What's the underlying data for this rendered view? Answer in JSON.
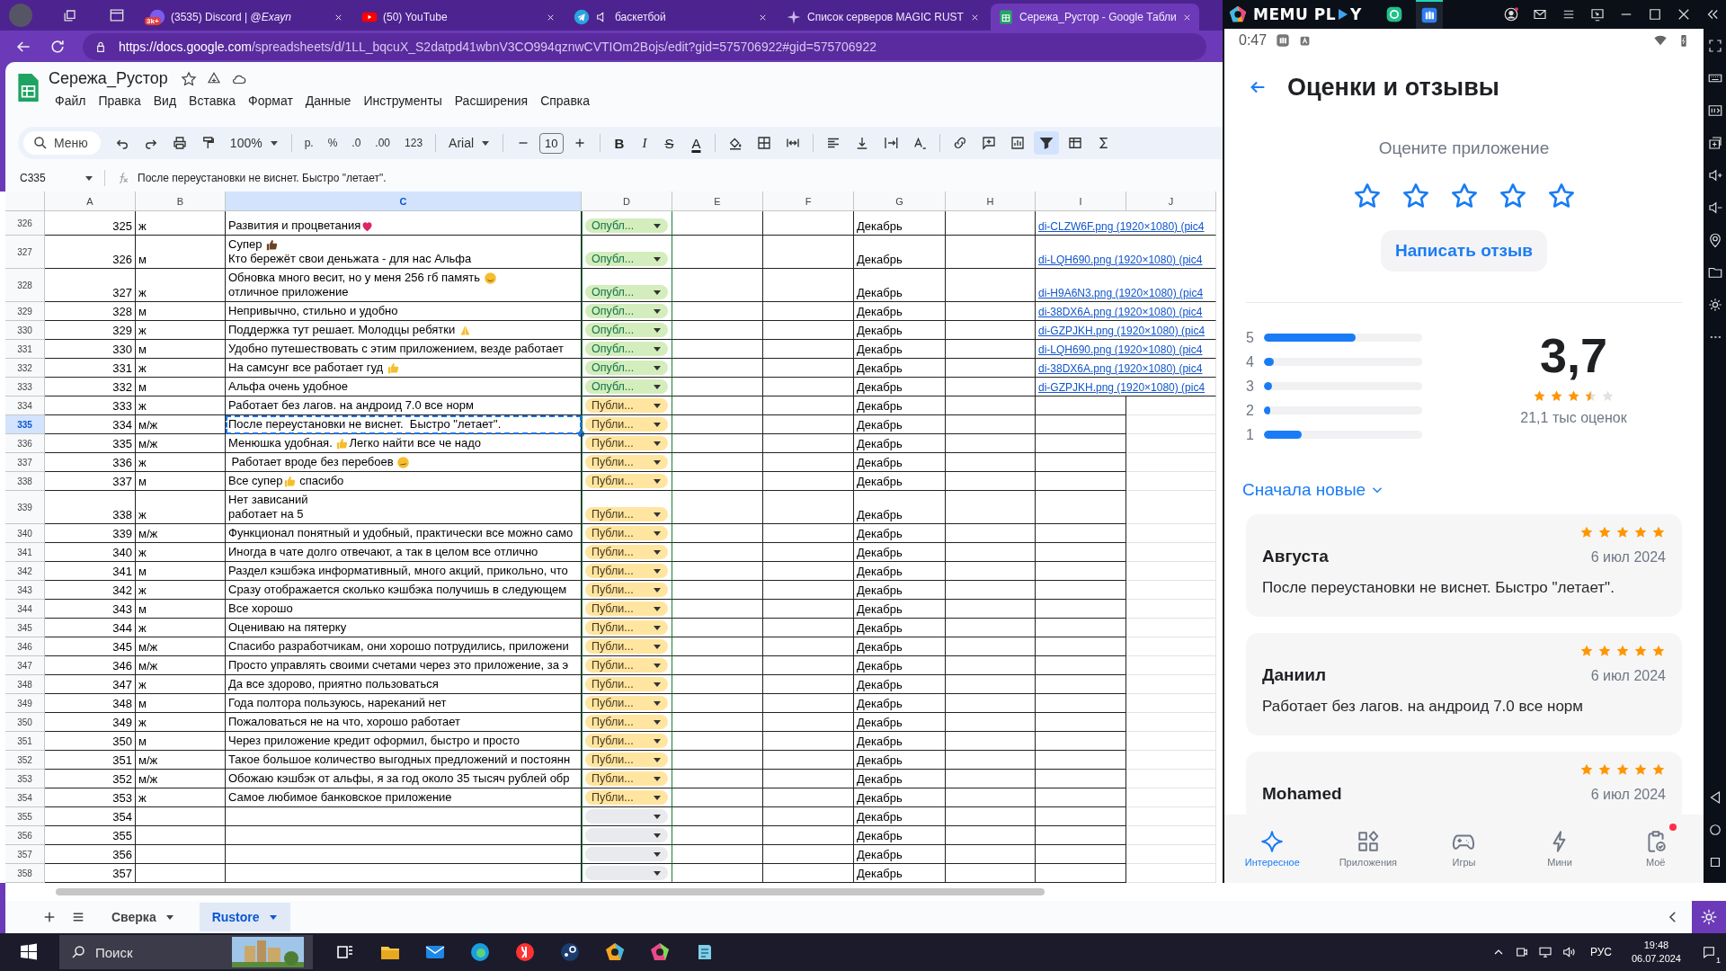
{
  "browser": {
    "tabs": [
      {
        "title": "(3535) Discord | @*Exayn*",
        "kind": "discord",
        "badge": "3k+",
        "audio": false,
        "selected": false
      },
      {
        "title": "(50) YouTube",
        "kind": "youtube",
        "audio": false,
        "selected": false
      },
      {
        "title": "баскетбой",
        "kind": "telegram",
        "audio": true,
        "selected": false
      },
      {
        "title": "Список серверов MAGIC RUST",
        "kind": "rust",
        "audio": false,
        "selected": false
      },
      {
        "title": "Сережа_Рустор - Google Табли",
        "kind": "sheets",
        "audio": false,
        "selected": true
      }
    ],
    "url_host": "https://docs.google.com",
    "url_path": "/spreadsheets/d/1LL_bqcuX_S2datpd41wbnV3CO994qznwCVTIOm2Bojs/edit?gid=575706922#gid=575706922"
  },
  "sheets": {
    "title": "Сережа_Рустор",
    "menu": [
      "Файл",
      "Правка",
      "Вид",
      "Вставка",
      "Формат",
      "Данные",
      "Инструменты",
      "Расширения",
      "Справка"
    ],
    "toolbar": [
      {
        "kind": "search",
        "label": "Меню"
      },
      {
        "kind": "undo",
        "active": false
      },
      {
        "kind": "redo",
        "active": false
      },
      {
        "kind": "print",
        "active": false
      },
      {
        "kind": "paint",
        "active": false
      },
      {
        "kind": "select",
        "label": "100%"
      },
      {
        "kind": "divider"
      },
      {
        "kind": "text",
        "label": "р."
      },
      {
        "kind": "text",
        "label": "%"
      },
      {
        "kind": "text",
        "label": ".0"
      },
      {
        "kind": "text",
        "label": ".00"
      },
      {
        "kind": "text",
        "label": "123"
      },
      {
        "kind": "divider"
      },
      {
        "kind": "select",
        "label": "Arial"
      },
      {
        "kind": "divider"
      },
      {
        "kind": "minus",
        "active": false
      },
      {
        "kind": "field",
        "label": "10"
      },
      {
        "kind": "plus",
        "active": false
      },
      {
        "kind": "divider"
      },
      {
        "kind": "bold",
        "label": "B"
      },
      {
        "kind": "italic",
        "label": "I"
      },
      {
        "kind": "strike",
        "label": "S"
      },
      {
        "kind": "color",
        "label": "A"
      },
      {
        "kind": "divider"
      },
      {
        "kind": "fill",
        "active": false
      },
      {
        "kind": "borders",
        "active": false
      },
      {
        "kind": "merge",
        "active": false
      },
      {
        "kind": "divider"
      },
      {
        "kind": "align",
        "active": false
      },
      {
        "kind": "valign",
        "active": false
      },
      {
        "kind": "wrap",
        "active": false
      },
      {
        "kind": "rotate",
        "active": false
      },
      {
        "kind": "divider"
      },
      {
        "kind": "link",
        "active": false
      },
      {
        "kind": "comment",
        "active": false
      },
      {
        "kind": "chart",
        "active": false
      },
      {
        "kind": "filter",
        "active": true
      },
      {
        "kind": "table",
        "active": false
      },
      {
        "kind": "sigma",
        "active": false
      }
    ],
    "cell_ref": "C335",
    "formula": "После переустановки не виснет.  Быстро \"летает\".",
    "columns": [
      {
        "label": "A",
        "selected": false
      },
      {
        "label": "B",
        "selected": false
      },
      {
        "label": "C",
        "selected": true
      },
      {
        "label": "D",
        "selected": false
      },
      {
        "label": "E",
        "selected": false
      },
      {
        "label": "F",
        "selected": false
      },
      {
        "label": "G",
        "selected": false
      },
      {
        "label": "H",
        "selected": false
      },
      {
        "label": "I",
        "selected": false
      },
      {
        "label": "J",
        "selected": false
      }
    ],
    "rows": [
      {
        "n": "326",
        "a": "325",
        "b": "ж",
        "c": [
          [
            {
              "text": "Развития и процветания"
            },
            {
              "kind": "heart"
            }
          ]
        ],
        "kind": "published",
        "status_text": "Опубл...",
        "g": "Декабрь",
        "link": "di-CLZW6F.png (1920×1080) (pic4",
        "selected": false
      },
      {
        "n": "327",
        "a": "326",
        "b": "м",
        "c": [
          [
            {
              "text": "Супер "
            },
            {
              "kind": "thumb-dark"
            }
          ],
          [
            {
              "text": "Кто бережёт свои деньжата - для нас Альфа"
            }
          ]
        ],
        "kind": "published",
        "status_text": "Опубл...",
        "g": "Декабрь",
        "link": "di-LQH690.png (1920×1080) (pic4",
        "selected": false
      },
      {
        "n": "328",
        "a": "327",
        "b": "ж",
        "c": [
          [
            {
              "text": "Обновка много весит, но у меня 256 гб память "
            },
            {
              "kind": "smile"
            }
          ],
          [
            {
              "text": "отличное приложение"
            }
          ]
        ],
        "kind": "published",
        "status_text": "Опубл...",
        "g": "Декабрь",
        "link": "di-H9A6N3.png (1920×1080) (pic4",
        "selected": false
      },
      {
        "n": "329",
        "a": "328",
        "b": "м",
        "c": [
          [
            {
              "text": "Непривычно, стильно и удобно"
            }
          ]
        ],
        "kind": "published",
        "status_text": "Опубл...",
        "g": "Декабрь",
        "link": "di-38DX6A.png (1920×1080) (pic4",
        "selected": false
      },
      {
        "n": "330",
        "a": "329",
        "b": "ж",
        "c": [
          [
            {
              "text": "Поддержка тут решает. Молодцы ребятки "
            },
            {
              "kind": "pray"
            }
          ]
        ],
        "kind": "published",
        "status_text": "Опубл...",
        "g": "Декабрь",
        "link": "di-GZPJKH.png (1920×1080) (pic4",
        "selected": false
      },
      {
        "n": "331",
        "a": "330",
        "b": "м",
        "c": [
          [
            {
              "text": "Удобно путешествовать с этим приложением, везде работает"
            }
          ]
        ],
        "kind": "published",
        "status_text": "Опубл...",
        "g": "Декабрь",
        "link": "di-LQH690.png (1920×1080) (pic4",
        "selected": false
      },
      {
        "n": "332",
        "a": "331",
        "b": "ж",
        "c": [
          [
            {
              "text": "На самсунг все работает гуд "
            },
            {
              "kind": "thumb"
            }
          ]
        ],
        "kind": "published",
        "status_text": "Опубл...",
        "g": "Декабрь",
        "link": "di-38DX6A.png (1920×1080) (pic4",
        "selected": false
      },
      {
        "n": "333",
        "a": "332",
        "b": "м",
        "c": [
          [
            {
              "text": "Альфа очень удобное"
            }
          ]
        ],
        "kind": "published",
        "status_text": "Опубл...",
        "g": "Декабрь",
        "link": "di-GZPJKH.png (1920×1080) (pic4",
        "selected": false
      },
      {
        "n": "334",
        "a": "333",
        "b": "ж",
        "c": [
          [
            {
              "text": "Работает без лагов. на андроид 7.0 все норм"
            }
          ]
        ],
        "kind": "pending",
        "status_text": "Публи...",
        "g": "Декабрь",
        "selected": false
      },
      {
        "n": "335",
        "a": "334",
        "b": "м/ж",
        "c": [
          [
            {
              "text": "После переустановки не виснет.  Быстро \"летает\"."
            }
          ]
        ],
        "kind": "pending",
        "status_text": "Публи...",
        "g": "Декабрь",
        "selected": true
      },
      {
        "n": "336",
        "a": "335",
        "b": "м/ж",
        "c": [
          [
            {
              "text": "Менюшка удобная. "
            },
            {
              "kind": "thumb"
            },
            {
              "text": "Легко найти все че надо"
            }
          ]
        ],
        "kind": "pending",
        "status_text": "Публи...",
        "g": "Декабрь",
        "selected": false
      },
      {
        "n": "337",
        "a": "336",
        "b": "ж",
        "c": [
          [
            {
              "text": " Работает вроде без перебоев "
            },
            {
              "kind": "confused"
            }
          ]
        ],
        "kind": "pending",
        "status_text": "Публи...",
        "g": "Декабрь",
        "selected": false
      },
      {
        "n": "338",
        "a": "337",
        "b": "м",
        "c": [
          [
            {
              "text": "Все супер"
            },
            {
              "kind": "thumb"
            },
            {
              "text": " спасибо"
            }
          ]
        ],
        "kind": "pending",
        "status_text": "Публи...",
        "g": "Декабрь",
        "selected": false
      },
      {
        "n": "339",
        "a": "338",
        "b": "ж",
        "c": [
          [
            {
              "text": "Нет зависаний"
            }
          ],
          [
            {
              "text": "работает на 5"
            }
          ]
        ],
        "kind": "pending",
        "status_text": "Публи...",
        "g": "Декабрь",
        "selected": false
      },
      {
        "n": "340",
        "a": "339",
        "b": "м/ж",
        "c": [
          [
            {
              "text": "Функционал понятный и удобный, практически все можно само"
            }
          ]
        ],
        "kind": "pending",
        "status_text": "Публи...",
        "g": "Декабрь",
        "selected": false
      },
      {
        "n": "341",
        "a": "340",
        "b": "ж",
        "c": [
          [
            {
              "text": "Иногда в чате долго отвечают, а так в целом все отлично"
            }
          ]
        ],
        "kind": "pending",
        "status_text": "Публи...",
        "g": "Декабрь",
        "selected": false
      },
      {
        "n": "342",
        "a": "341",
        "b": "м",
        "c": [
          [
            {
              "text": "Раздел кэшбэка информативный, много акций, прикольно, что"
            }
          ]
        ],
        "kind": "pending",
        "status_text": "Публи...",
        "g": "Декабрь",
        "selected": false
      },
      {
        "n": "343",
        "a": "342",
        "b": "ж",
        "c": [
          [
            {
              "text": "Сразу отображается сколько кэшбэка получишь в следующем"
            }
          ]
        ],
        "kind": "pending",
        "status_text": "Публи...",
        "g": "Декабрь",
        "selected": false
      },
      {
        "n": "344",
        "a": "343",
        "b": "м",
        "c": [
          [
            {
              "text": "Все хорошо"
            }
          ]
        ],
        "kind": "pending",
        "status_text": "Публи...",
        "g": "Декабрь",
        "selected": false
      },
      {
        "n": "345",
        "a": "344",
        "b": "ж",
        "c": [
          [
            {
              "text": "Оцениваю на пятерку"
            }
          ]
        ],
        "kind": "pending",
        "status_text": "Публи...",
        "g": "Декабрь",
        "selected": false
      },
      {
        "n": "346",
        "a": "345",
        "b": "м/ж",
        "c": [
          [
            {
              "text": "Спасибо разработчикам, они хорошо потрудились, приложени"
            }
          ]
        ],
        "kind": "pending",
        "status_text": "Публи...",
        "g": "Декабрь",
        "selected": false
      },
      {
        "n": "347",
        "a": "346",
        "b": "м/ж",
        "c": [
          [
            {
              "text": "Просто управлять своими счетами через это приложение, за э"
            }
          ]
        ],
        "kind": "pending",
        "status_text": "Публи...",
        "g": "Декабрь",
        "selected": false
      },
      {
        "n": "348",
        "a": "347",
        "b": "ж",
        "c": [
          [
            {
              "text": "Да все здорово, приятно пользоваться"
            }
          ]
        ],
        "kind": "pending",
        "status_text": "Публи...",
        "g": "Декабрь",
        "selected": false
      },
      {
        "n": "349",
        "a": "348",
        "b": "м",
        "c": [
          [
            {
              "text": "Года полтора пользуюсь, нареканий нет"
            }
          ]
        ],
        "kind": "pending",
        "status_text": "Публи...",
        "g": "Декабрь",
        "selected": false
      },
      {
        "n": "350",
        "a": "349",
        "b": "ж",
        "c": [
          [
            {
              "text": "Пожаловаться не на что, хорошо работает"
            }
          ]
        ],
        "kind": "pending",
        "status_text": "Публи...",
        "g": "Декабрь",
        "selected": false
      },
      {
        "n": "351",
        "a": "350",
        "b": "м",
        "c": [
          [
            {
              "text": "Через приложение кредит оформил, быстро и просто"
            }
          ]
        ],
        "kind": "pending",
        "status_text": "Публи...",
        "g": "Декабрь",
        "selected": false
      },
      {
        "n": "352",
        "a": "351",
        "b": "м/ж",
        "c": [
          [
            {
              "text": "Такое большое количество выгодных предложений и постоянн"
            }
          ]
        ],
        "kind": "pending",
        "status_text": "Публи...",
        "g": "Декабрь",
        "selected": false
      },
      {
        "n": "353",
        "a": "352",
        "b": "м/ж",
        "c": [
          [
            {
              "text": "Обожаю кэшбэк от альфы, я за год около 35 тысяч рублей обр"
            }
          ]
        ],
        "kind": "pending",
        "status_text": "Публи...",
        "g": "Декабрь",
        "selected": false
      },
      {
        "n": "354",
        "a": "353",
        "b": "ж",
        "c": [
          [
            {
              "text": "Самое любимое банковское приложение"
            }
          ]
        ],
        "kind": "pending",
        "status_text": "Публи...",
        "g": "Декабрь",
        "selected": false
      },
      {
        "n": "355",
        "a": "354",
        "c": [],
        "kind": "empty",
        "g": "Декабрь",
        "selected": false
      },
      {
        "n": "356",
        "a": "355",
        "c": [],
        "kind": "empty",
        "g": "Декабрь",
        "selected": false
      },
      {
        "n": "357",
        "a": "356",
        "c": [],
        "kind": "empty",
        "g": "Декабрь",
        "selected": false
      },
      {
        "n": "358",
        "a": "357",
        "c": [],
        "kind": "empty",
        "g": "Декабрь",
        "selected": false
      }
    ],
    "sheet_tabs": [
      {
        "label": "Сверка",
        "selected": false
      },
      {
        "label": "Rustore",
        "selected": true
      }
    ]
  },
  "emulator": {
    "logo_left": "MEMU PL",
    "logo_right": "Y"
  },
  "phone": {
    "time": "0:47",
    "title": "Оценки и отзывы",
    "rate_prompt": "Оцените приложение",
    "write_button": "Написать отзыв",
    "distribution": [
      {
        "label": "5",
        "level": 0.58
      },
      {
        "label": "4",
        "level": 0.06
      },
      {
        "label": "3",
        "level": 0.05
      },
      {
        "label": "2",
        "level": 0.04
      },
      {
        "label": "1",
        "level": 0.24
      }
    ],
    "average": "3,7",
    "stars": 3.5,
    "count": "21,1 тыс оценок",
    "sort": "Сначала новые",
    "reviews": [
      {
        "author": "Августа",
        "date": "6 июл 2024",
        "text": "После переустановки не виснет.  Быстро \"летает\".",
        "stars": 5
      },
      {
        "author": "Даниил",
        "date": "6 июл 2024",
        "text": "Работает без лагов. на андроид 7.0 все норм",
        "stars": 5
      },
      {
        "author": "Mohamed",
        "date": "6 июл 2024",
        "stars": 5
      }
    ],
    "nav": [
      {
        "label": "Интересное",
        "kind": "sparkle",
        "selected": true,
        "badge": false
      },
      {
        "label": "Приложения",
        "kind": "apps",
        "selected": false,
        "badge": false
      },
      {
        "label": "Игры",
        "kind": "gamepad",
        "selected": false,
        "badge": false
      },
      {
        "label": "Мини",
        "kind": "bolt",
        "selected": false,
        "badge": false
      },
      {
        "label": "Моё",
        "kind": "mine",
        "selected": false,
        "badge": true
      }
    ]
  },
  "taskbar": {
    "search": "Поиск",
    "lang": "РУС",
    "time": "19:48",
    "date": "06.07.2024",
    "notifications": "1"
  }
}
